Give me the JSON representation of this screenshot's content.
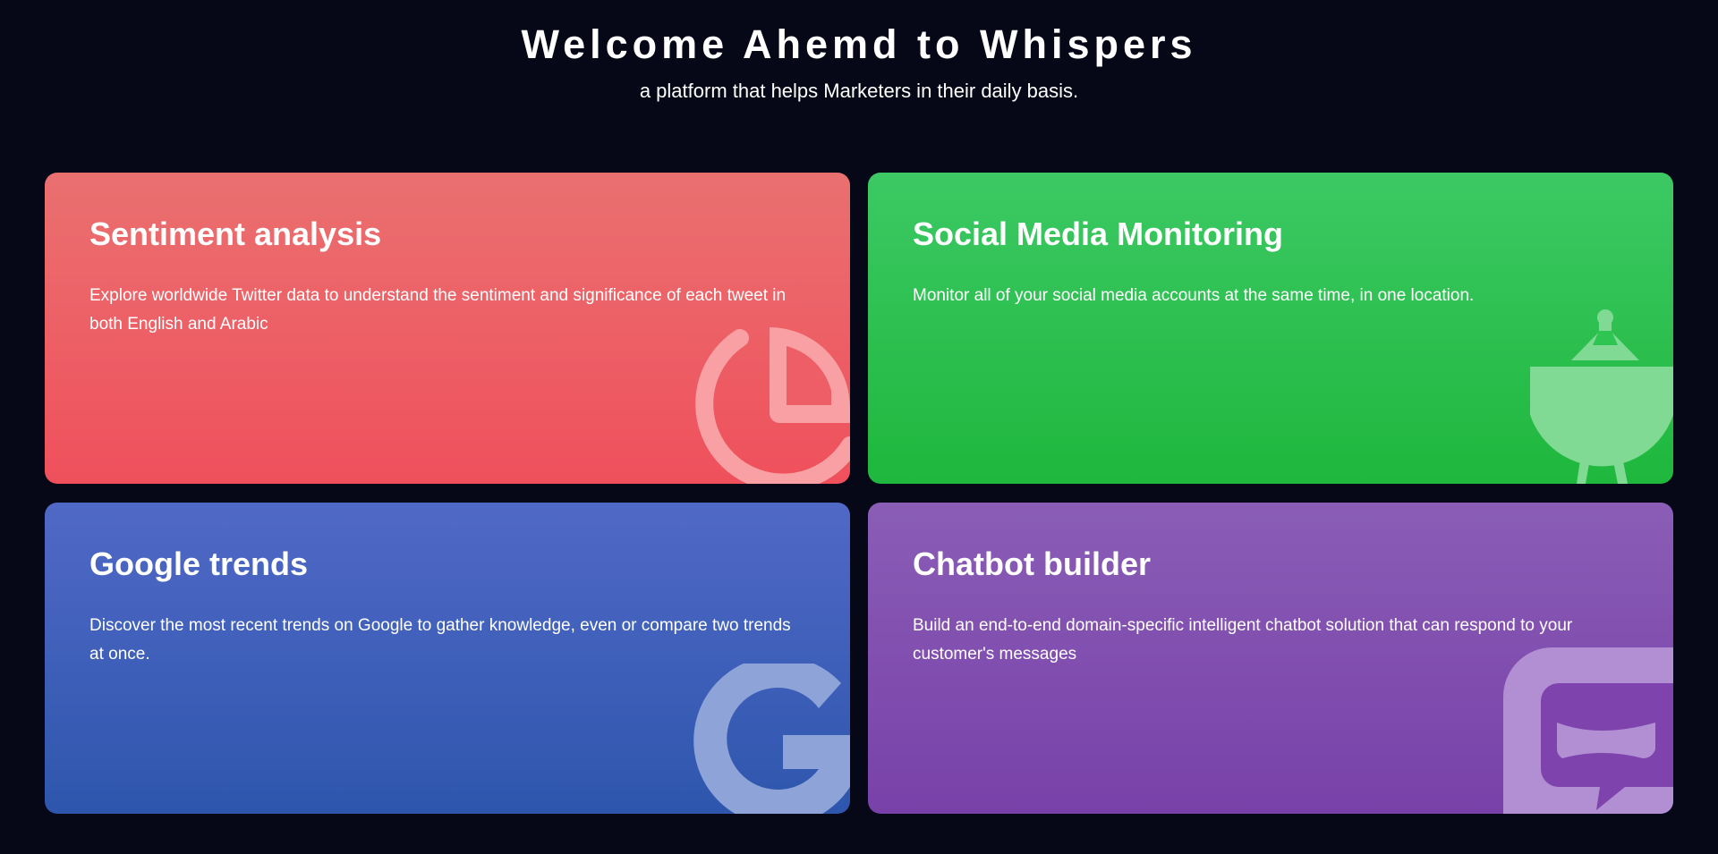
{
  "header": {
    "title": "Welcome Ahemd to Whispers",
    "subtitle": "a platform that helps Marketers in their daily basis."
  },
  "cards": [
    {
      "title": "Sentiment analysis",
      "description": "Explore worldwide Twitter data to understand the sentiment and significance of each tweet in both English and Arabic",
      "icon": "pie-chart-icon",
      "color": "#ee5f67"
    },
    {
      "title": "Social Media Monitoring",
      "description": "Monitor all of your social media accounts at the same time, in one location.",
      "icon": "satellite-dish-icon",
      "color": "#27bf4b"
    },
    {
      "title": "Google trends",
      "description": "Discover the most recent trends on Google to gather knowledge, even or compare two trends at once.",
      "icon": "google-g-icon",
      "color": "#3f5fba"
    },
    {
      "title": "Chatbot builder",
      "description": "Build an end-to-end domain-specific intelligent chatbot solution that can respond to your customer's messages",
      "icon": "chatbot-icon",
      "color": "#814fb0"
    }
  ]
}
